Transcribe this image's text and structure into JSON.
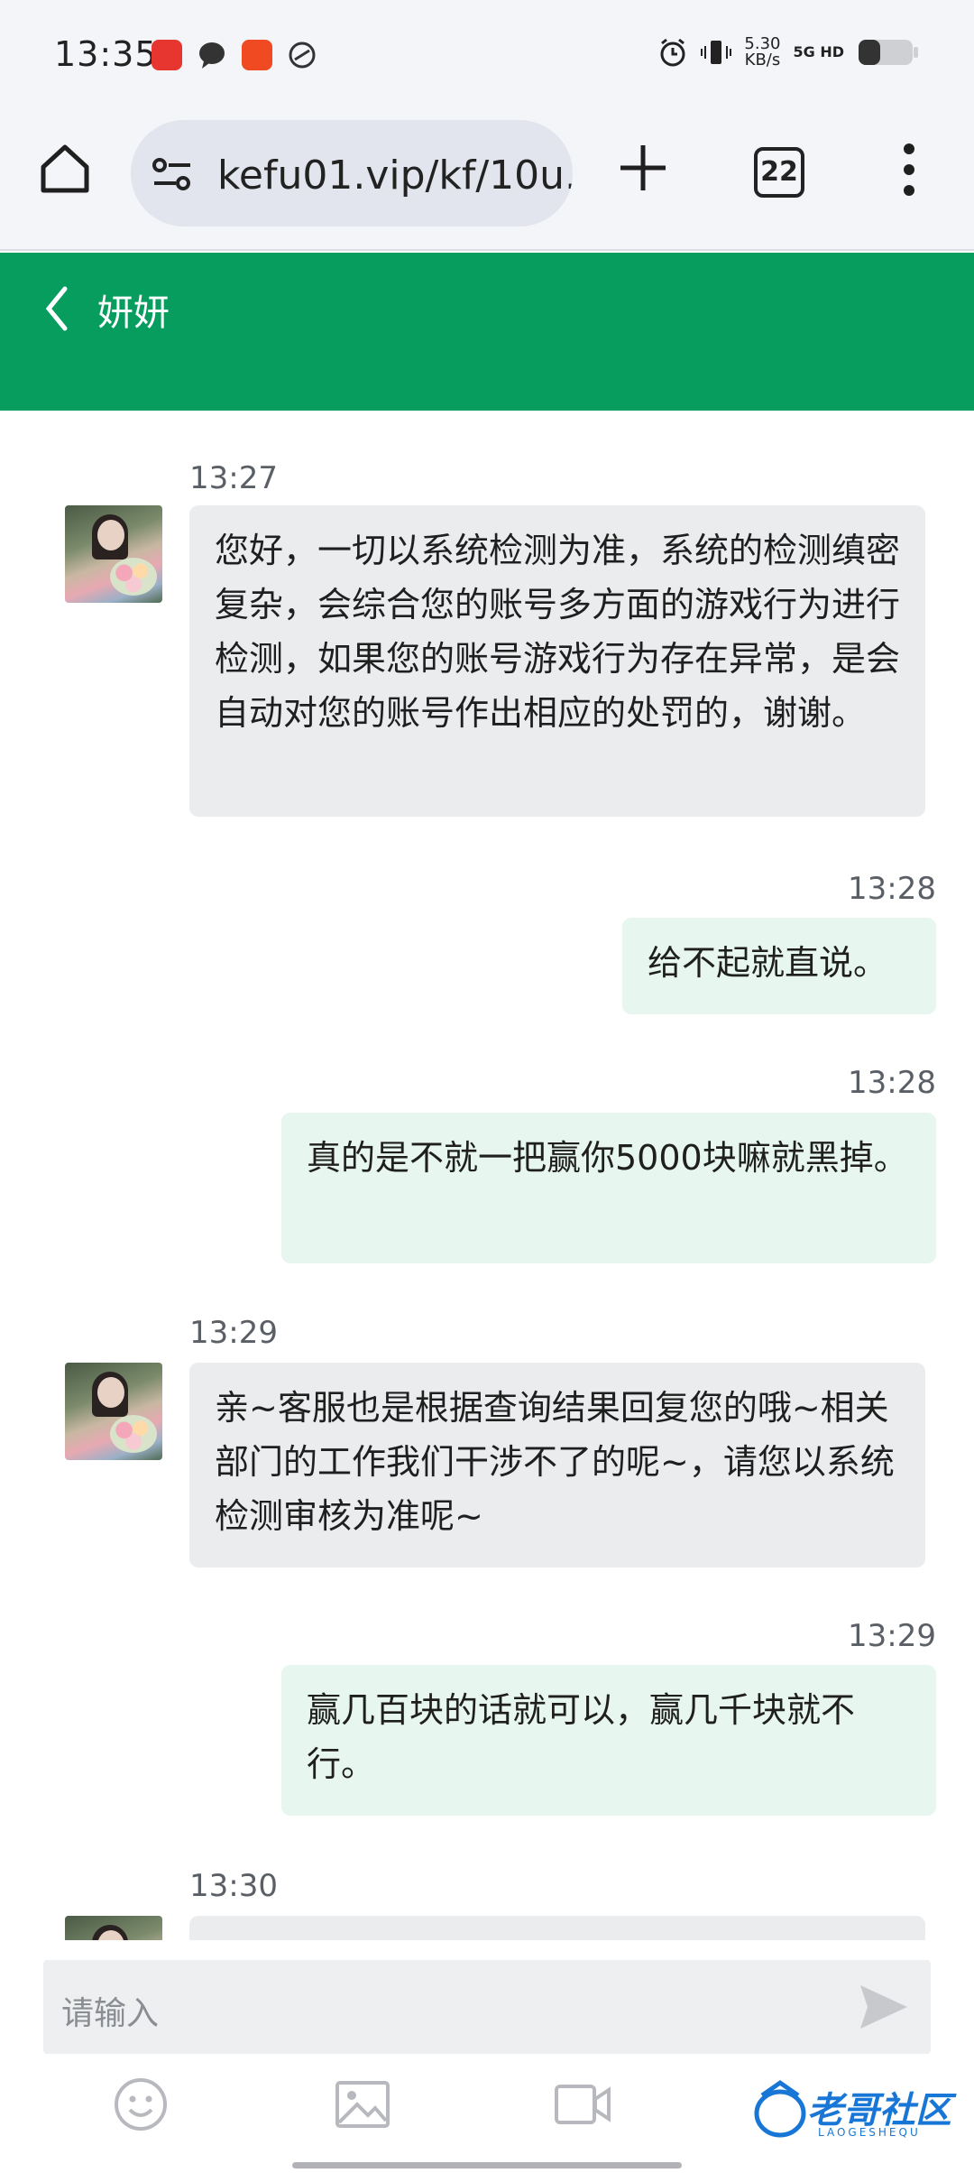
{
  "status_bar": {
    "time": "13:35",
    "speed_value": "5.30",
    "speed_unit": "KB/s",
    "network": "5G HD",
    "icons": [
      "app-icon-red",
      "chat-bubble-icon",
      "app-icon-orange",
      "link-icon",
      "alarm-icon",
      "vibrate-icon",
      "signal-icon",
      "battery-icon"
    ]
  },
  "browser": {
    "url": "kefu01.vip/kf/10u.",
    "tab_count": "22"
  },
  "chat": {
    "title": "妍妍"
  },
  "messages": [
    {
      "time": "13:27",
      "side": "in",
      "text": "您好，一切以系统检测为准，系统的检测缜密复杂，会综合您的账号多方面的游戏行为进行检测，如果您的账号游戏行为存在异常，是会自动对您的账号作出相应的处罚的，谢谢。"
    },
    {
      "time": "13:28",
      "side": "out",
      "text": "给不起就直说。"
    },
    {
      "time": "13:28",
      "side": "out",
      "text": "真的是不就一把赢你5000块嘛就黑掉。"
    },
    {
      "time": "13:29",
      "side": "in",
      "text": "亲~客服也是根据查询结果回复您的哦~相关部门的工作我们干涉不了的呢~，请您以系统检测审核为准呢~"
    },
    {
      "time": "13:29",
      "side": "out",
      "text": "赢几百块的话就可以，赢几千块就不行。"
    },
    {
      "time": "13:30",
      "side": "in",
      "text": ""
    }
  ],
  "input": {
    "placeholder": "请输入"
  },
  "watermark": {
    "text": "老哥社区",
    "sub": "LAOGESHEQU"
  },
  "colors": {
    "header": "#069d5f",
    "bubble_in": "#ebecee",
    "bubble_out": "#e7f6ee"
  }
}
